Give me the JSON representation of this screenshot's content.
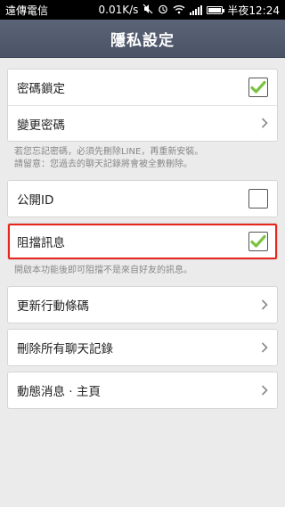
{
  "status_bar": {
    "carrier": "遠傳電信",
    "net_speed": "0.01K/s",
    "time": "半夜12:24",
    "icons": [
      "mute-icon",
      "alarm-icon",
      "wifi-icon",
      "signal-icon",
      "battery-icon"
    ]
  },
  "header": {
    "title": "隱私設定"
  },
  "sections": {
    "password_lock": {
      "label": "密碼鎖定",
      "checked": true
    },
    "change_password": {
      "label": "變更密碼"
    },
    "password_note": {
      "line1": "若您忘記密碼，必須先刪除LINE，再重新安裝。",
      "line2": "請留意：您過去的聊天記錄將會被全數刪除。"
    },
    "public_id": {
      "label": "公開ID",
      "checked": false
    },
    "block_messages": {
      "label": "阻擋訊息",
      "checked": true
    },
    "block_note": "開啟本功能後即可阻擋不是來自好友的訊息。",
    "update_code": {
      "label": "更新行動條碼"
    },
    "delete_history": {
      "label": "刪除所有聊天記錄"
    },
    "timeline": {
      "label": "動態消息 · 主頁"
    }
  },
  "colors": {
    "check_green": "#7cc242",
    "highlight_red": "#e8261e",
    "header_bg": "#525a6e"
  }
}
